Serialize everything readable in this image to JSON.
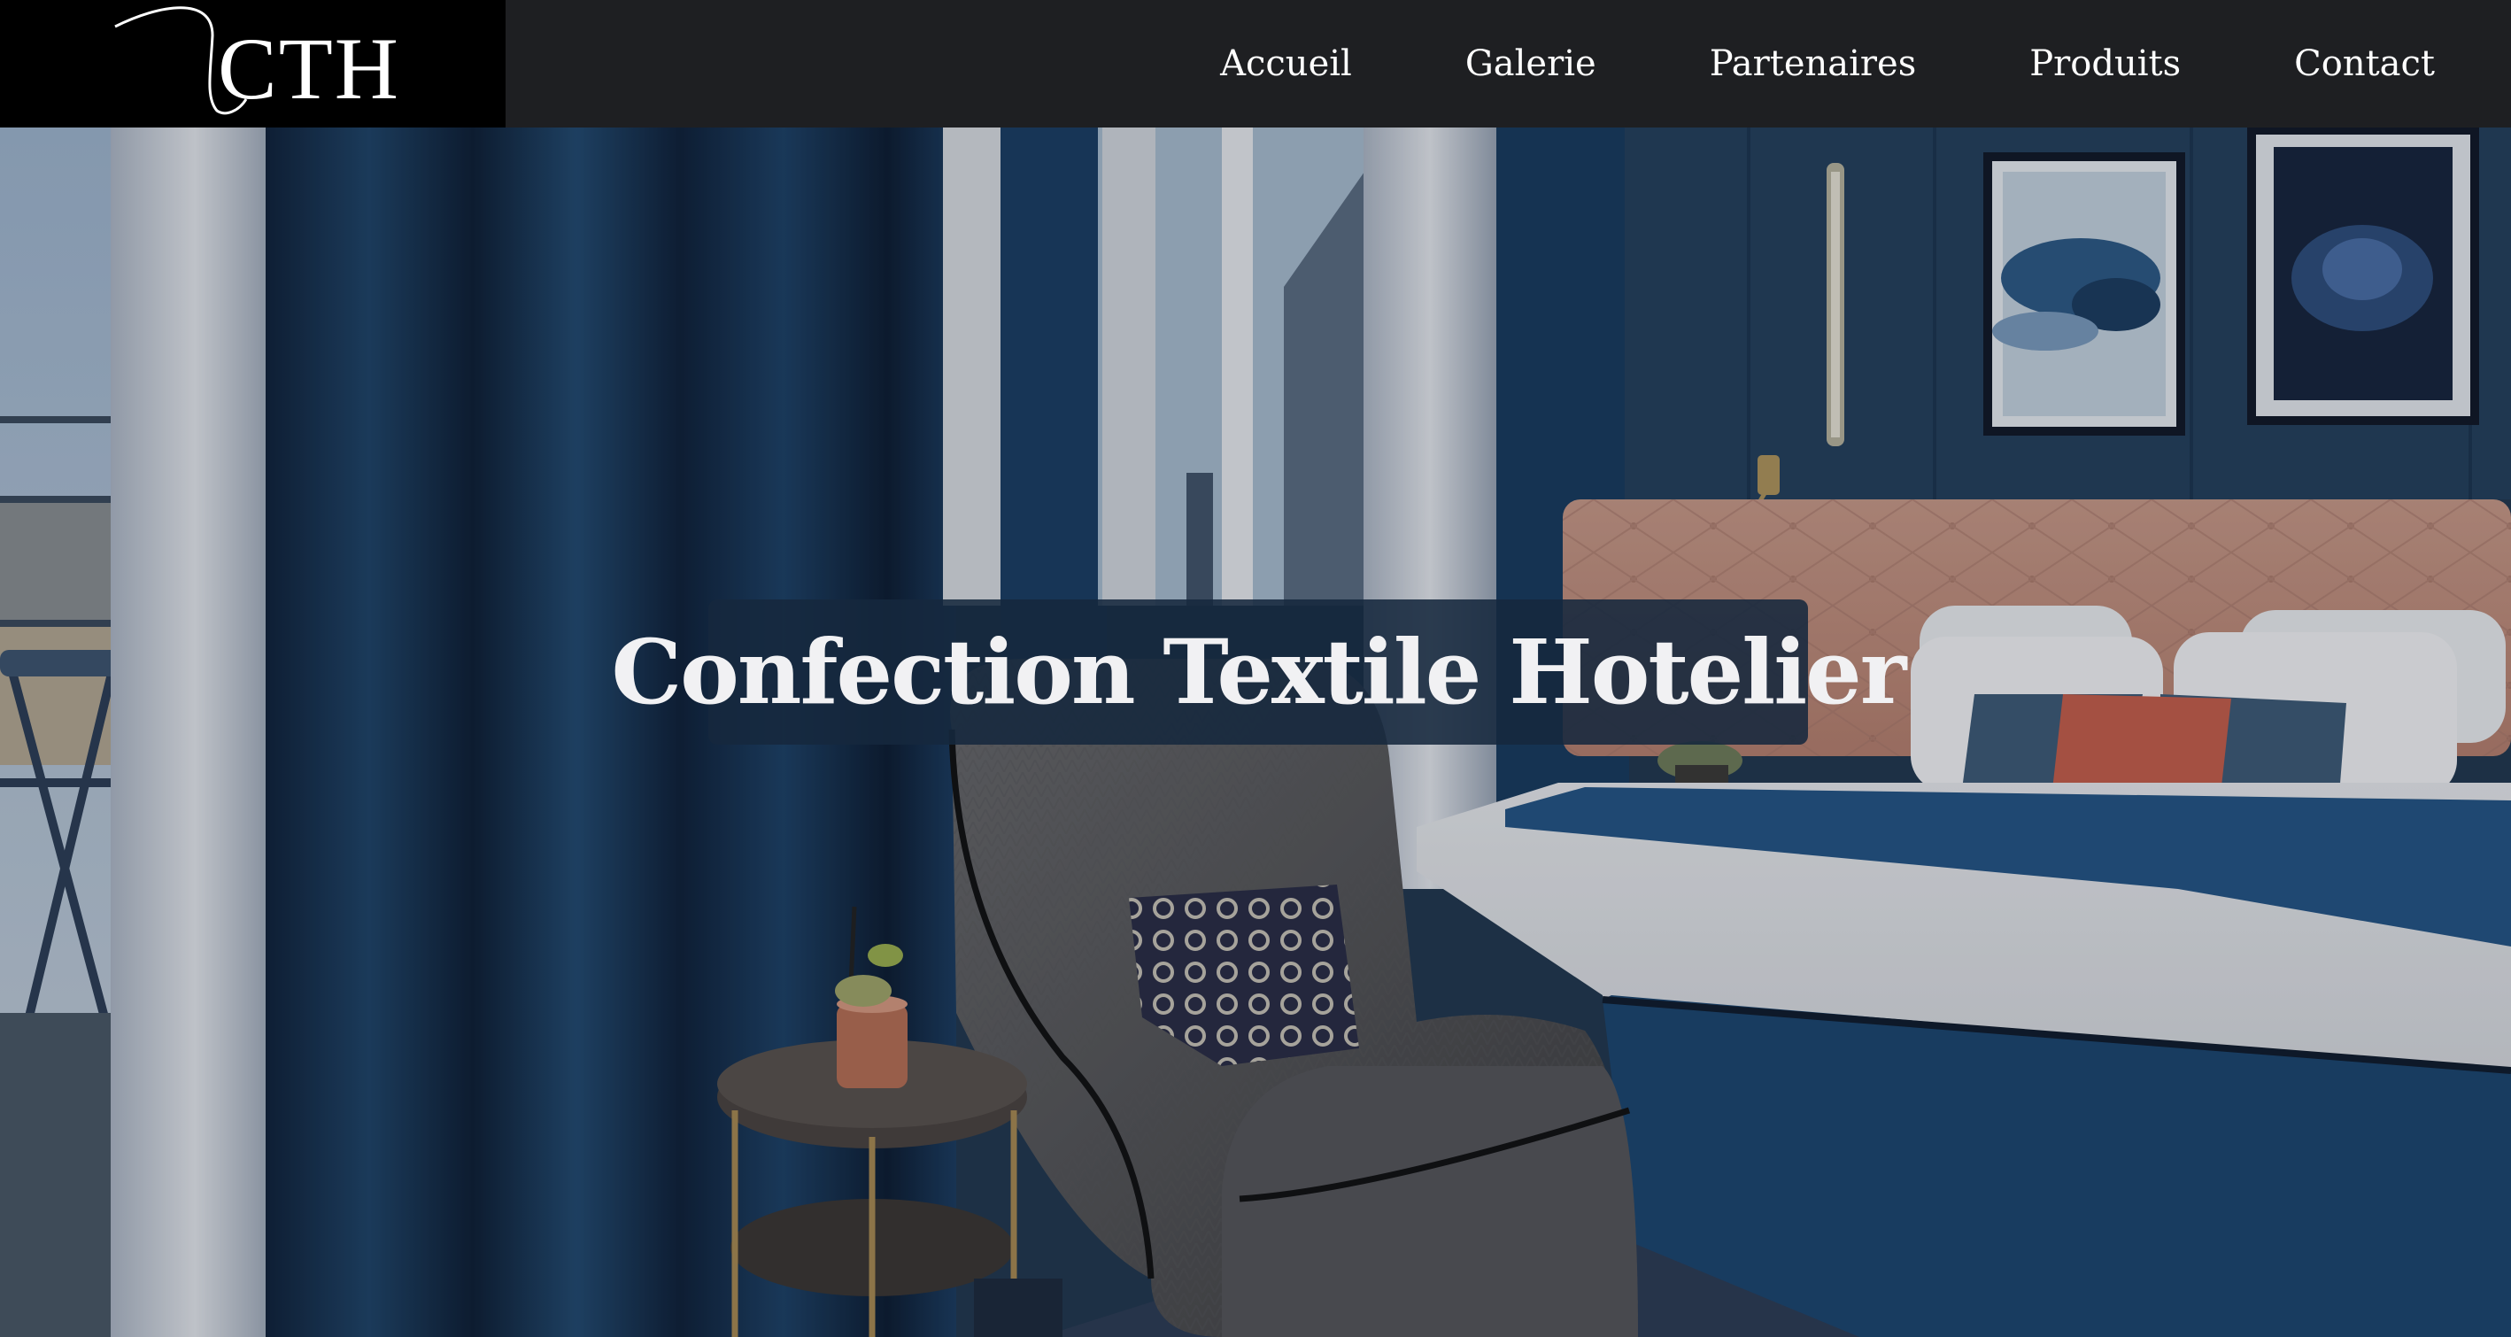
{
  "brand": {
    "logo_text": "CTH"
  },
  "nav": {
    "items": [
      {
        "label": "Accueil"
      },
      {
        "label": "Galerie"
      },
      {
        "label": "Partenaires"
      },
      {
        "label": "Produits"
      },
      {
        "label": "Contact"
      }
    ]
  },
  "hero": {
    "title": "Confection Textile Hotelier"
  },
  "colors": {
    "header_bg": "#1e1f22",
    "logo_bg": "#000000",
    "title_box_bg": "#16283e",
    "curtain_blue": "#1a3a5c",
    "headboard_pink": "#c98f7e"
  }
}
